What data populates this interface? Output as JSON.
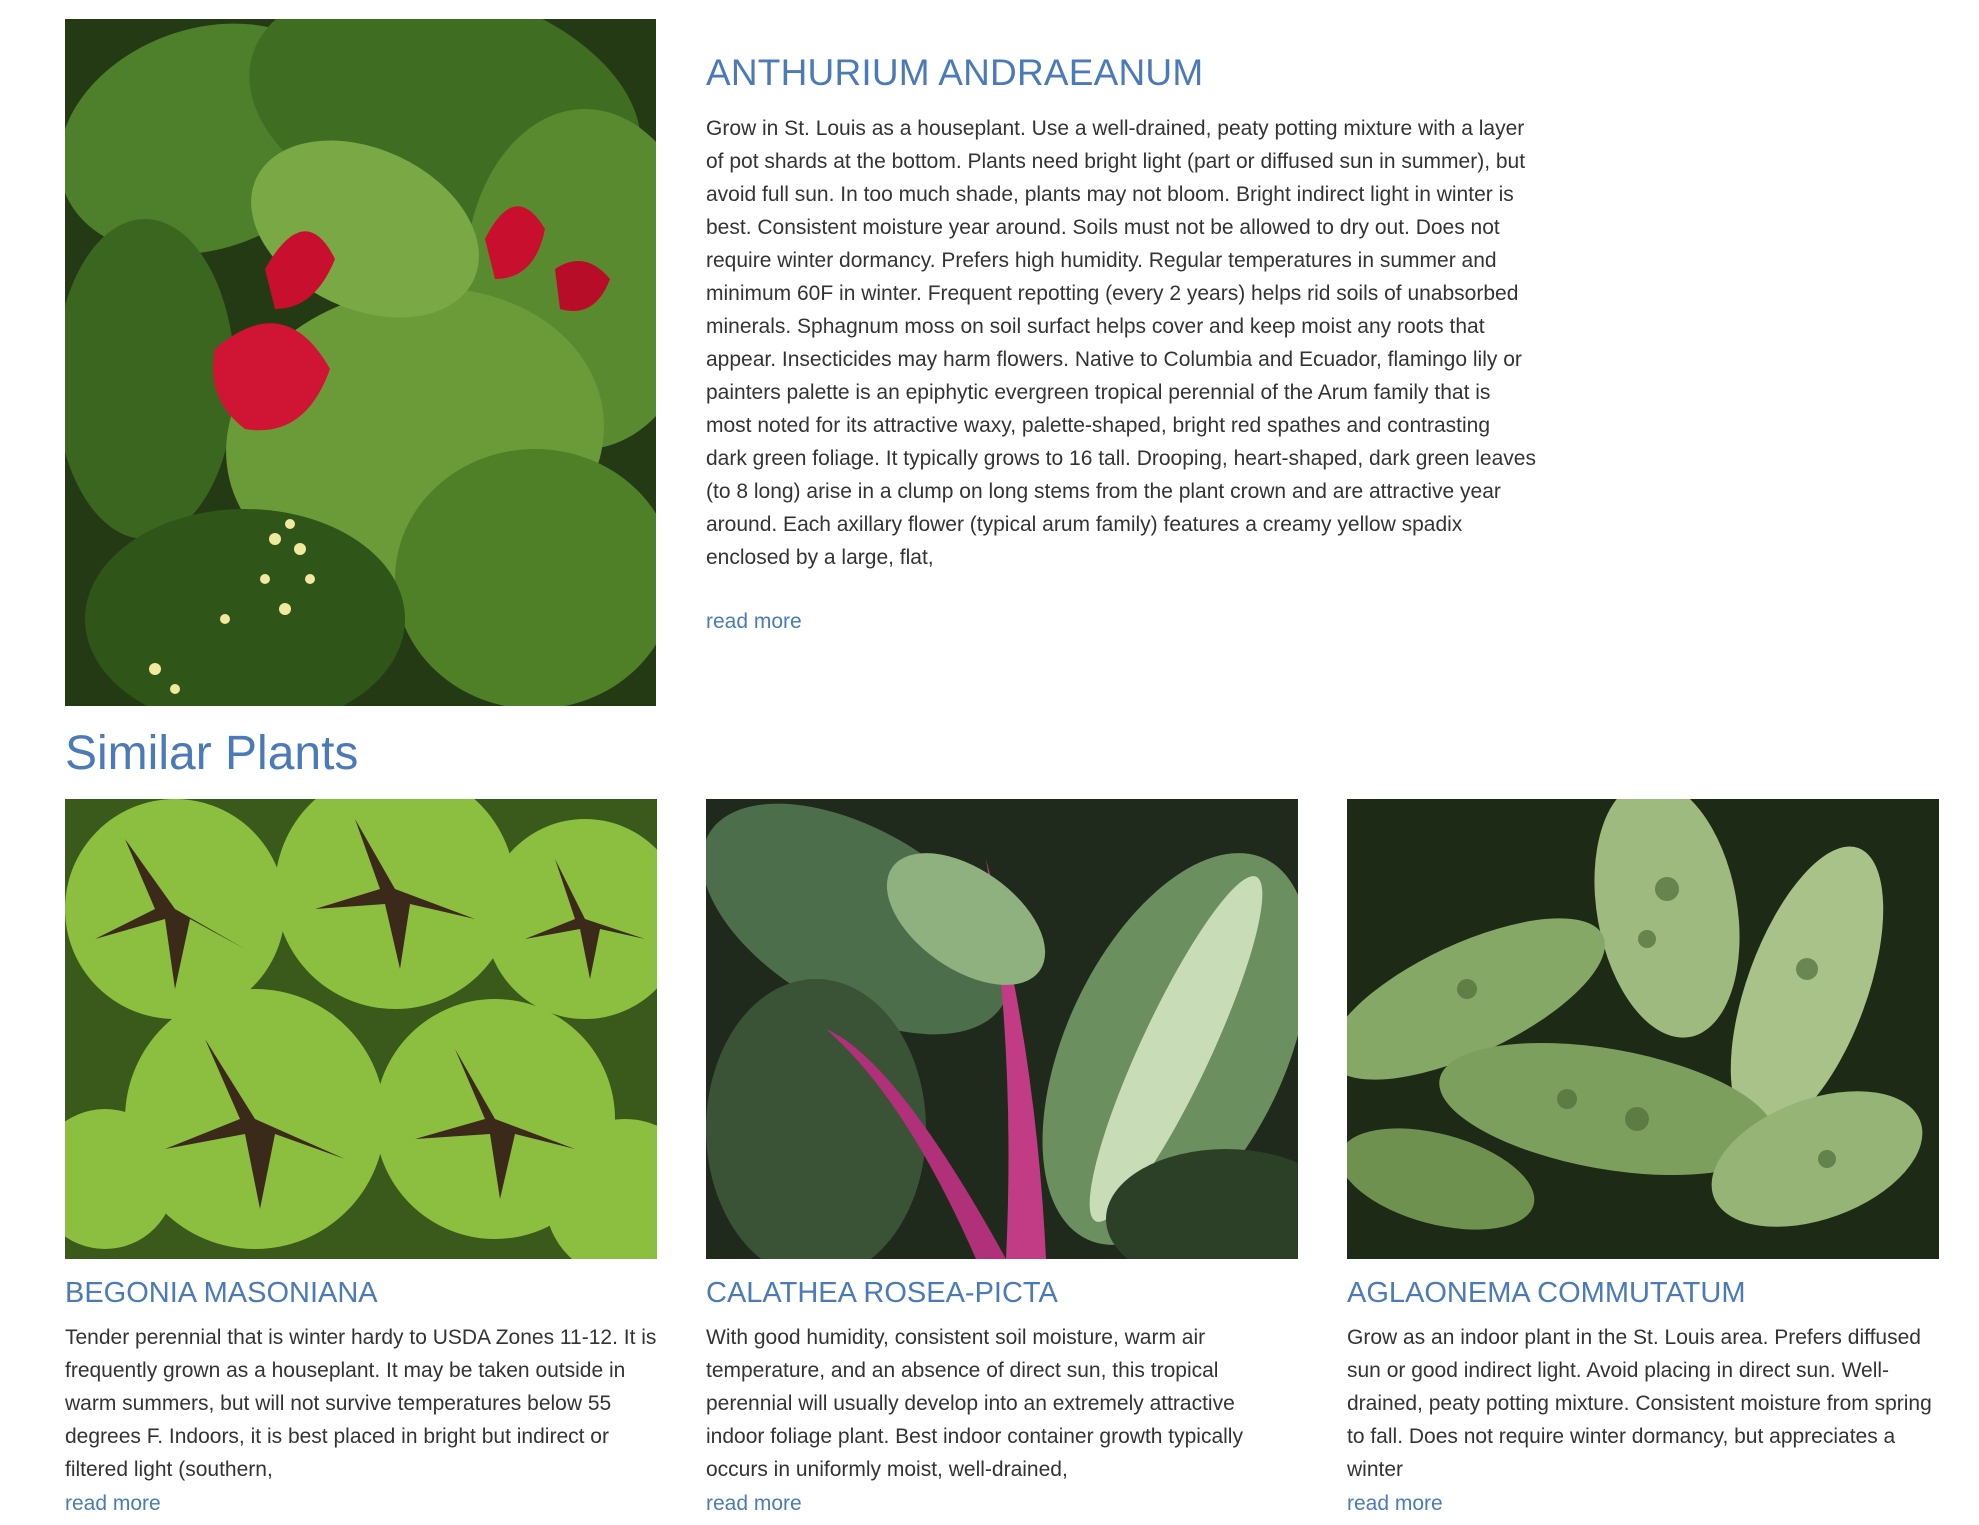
{
  "featured": {
    "title": "ANTHURIUM ANDRAEANUM",
    "description": "Grow in St. Louis as a houseplant. Use a well-drained, peaty potting mixture with a layer of pot shards at the bottom. Plants need bright light (part or diffused sun in summer), but avoid full sun. In too much shade, plants may not bloom. Bright indirect light in winter is best. Consistent moisture year around. Soils must not be allowed to dry out. Does not require winter dormancy. Prefers high humidity. Regular temperatures in summer and minimum 60F in winter. Frequent repotting (every 2 years) helps rid soils of unabsorbed minerals. Sphagnum moss on soil surfact helps cover and keep moist any roots that appear. Insecticides may harm flowers. Native to Columbia and Ecuador, flamingo lily or painters palette is an epiphytic evergreen tropical perennial of the Arum family that is most noted for its attractive waxy, palette-shaped, bright red spathes and contrasting dark green foliage. It typically grows to 16 tall. Drooping, heart-shaped, dark green leaves (to 8 long) arise in a clump on long stems from the plant crown and are attractive year around. Each axillary flower (typical arum family) features a creamy yellow spadix enclosed by a large, flat,",
    "read_more": "read more"
  },
  "similar": {
    "heading": "Similar Plants",
    "cards": [
      {
        "title": "BEGONIA MASONIANA",
        "description": "Tender perennial that is winter hardy to USDA Zones 11-12. It is frequently grown as a houseplant. It may be taken outside in warm summers, but will not survive temperatures below 55 degrees F. Indoors, it is best placed in bright but indirect or filtered light (southern,",
        "read_more": "read more"
      },
      {
        "title": "CALATHEA ROSEA-PICTA",
        "description": "With good humidity, consistent soil moisture, warm air temperature, and an absence of direct sun, this tropical perennial will usually develop into an extremely attractive indoor foliage plant. Best indoor container growth typically occurs in uniformly moist, well-drained,",
        "read_more": "read more"
      },
      {
        "title": "AGLAONEMA COMMUTATUM",
        "description": "Grow as an indoor plant in the St. Louis area. Prefers diffused sun or good indirect light. Avoid placing in direct sun. Well-drained, peaty potting mixture. Consistent moisture from spring to fall. Does not require winter dormancy, but appreciates a winter",
        "read_more": "read more"
      }
    ]
  },
  "colors": {
    "link_blue": "#4a7ab8",
    "body_text": "#333333"
  }
}
